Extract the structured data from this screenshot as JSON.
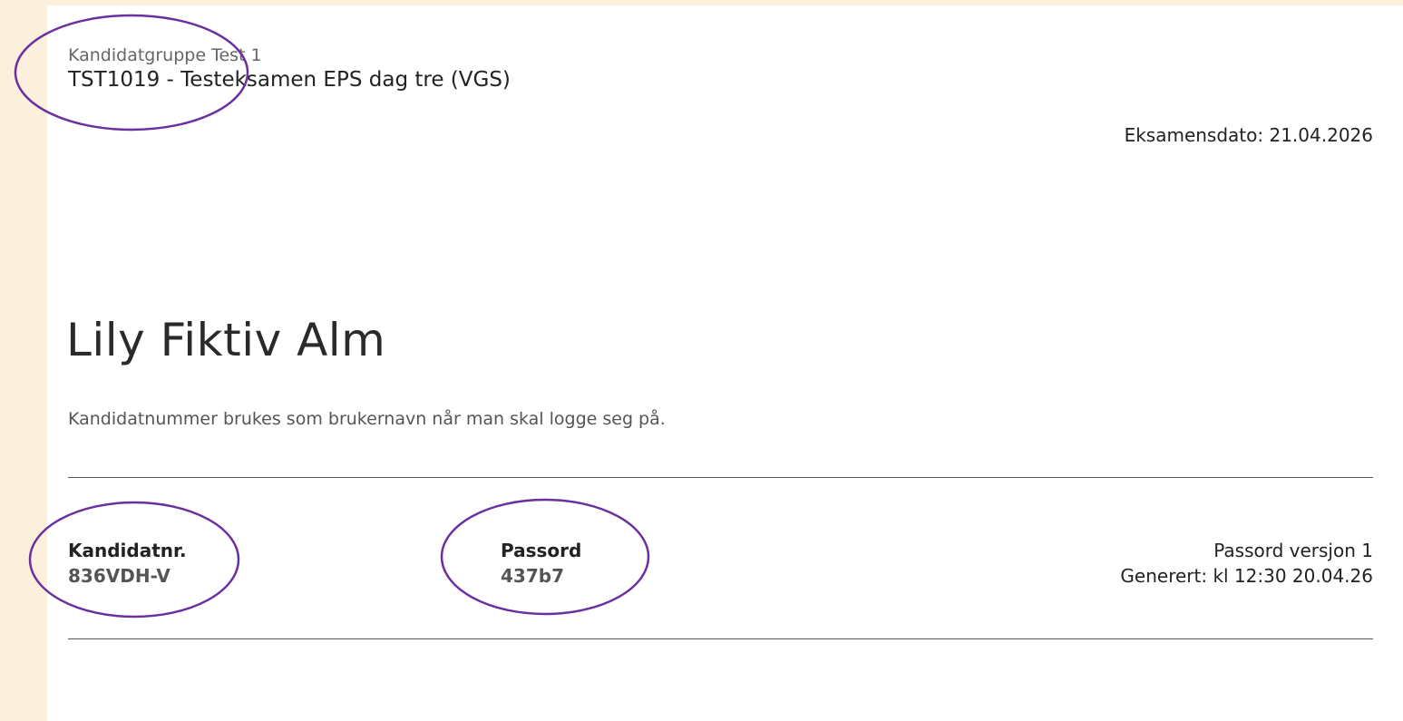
{
  "header": {
    "group_name": "Kandidatgruppe Test 1",
    "exam_title": "TST1019 - Testeksamen EPS dag tre (VGS)",
    "exam_date": "Eksamensdato: 21.04.2026"
  },
  "candidate": {
    "name": "Lily Fiktiv Alm",
    "login_hint": "Kandidatnummer brukes som brukernavn når man skal logge seg på."
  },
  "credentials": {
    "candidate_number_label": "Kandidatnr.",
    "candidate_number_value": "836VDH-V",
    "password_label": "Passord",
    "password_value": "437b7",
    "password_version": "Passord versjon 1",
    "generated": "Generert: kl 12:30 20.04.26"
  },
  "colors": {
    "page_background": "#faf0dc",
    "sheet_background": "#ffffff",
    "annotation_stroke": "#6b2fa0",
    "value_text": "#555555"
  }
}
